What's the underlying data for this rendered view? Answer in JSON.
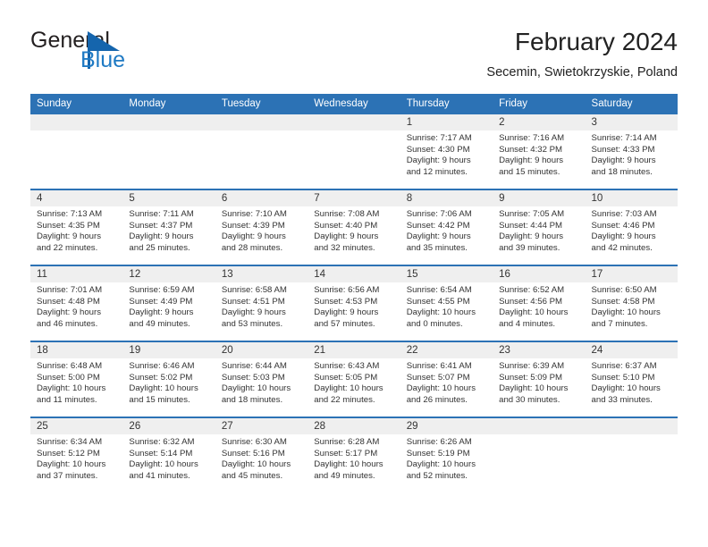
{
  "brand": {
    "name_part1": "General",
    "name_part2": "Blue",
    "mark": "triangle-logo"
  },
  "header": {
    "title": "February 2024",
    "subtitle": "Secemin, Swietokrzyskie, Poland"
  },
  "calendar": {
    "weekday_headers": [
      "Sunday",
      "Monday",
      "Tuesday",
      "Wednesday",
      "Thursday",
      "Friday",
      "Saturday"
    ],
    "accent_color": "#2c72b5",
    "daynum_band_color": "#efefef",
    "weeks": [
      [
        {
          "day": "",
          "lines": []
        },
        {
          "day": "",
          "lines": []
        },
        {
          "day": "",
          "lines": []
        },
        {
          "day": "",
          "lines": []
        },
        {
          "day": "1",
          "lines": [
            "Sunrise: 7:17 AM",
            "Sunset: 4:30 PM",
            "Daylight: 9 hours",
            "and 12 minutes."
          ]
        },
        {
          "day": "2",
          "lines": [
            "Sunrise: 7:16 AM",
            "Sunset: 4:32 PM",
            "Daylight: 9 hours",
            "and 15 minutes."
          ]
        },
        {
          "day": "3",
          "lines": [
            "Sunrise: 7:14 AM",
            "Sunset: 4:33 PM",
            "Daylight: 9 hours",
            "and 18 minutes."
          ]
        }
      ],
      [
        {
          "day": "4",
          "lines": [
            "Sunrise: 7:13 AM",
            "Sunset: 4:35 PM",
            "Daylight: 9 hours",
            "and 22 minutes."
          ]
        },
        {
          "day": "5",
          "lines": [
            "Sunrise: 7:11 AM",
            "Sunset: 4:37 PM",
            "Daylight: 9 hours",
            "and 25 minutes."
          ]
        },
        {
          "day": "6",
          "lines": [
            "Sunrise: 7:10 AM",
            "Sunset: 4:39 PM",
            "Daylight: 9 hours",
            "and 28 minutes."
          ]
        },
        {
          "day": "7",
          "lines": [
            "Sunrise: 7:08 AM",
            "Sunset: 4:40 PM",
            "Daylight: 9 hours",
            "and 32 minutes."
          ]
        },
        {
          "day": "8",
          "lines": [
            "Sunrise: 7:06 AM",
            "Sunset: 4:42 PM",
            "Daylight: 9 hours",
            "and 35 minutes."
          ]
        },
        {
          "day": "9",
          "lines": [
            "Sunrise: 7:05 AM",
            "Sunset: 4:44 PM",
            "Daylight: 9 hours",
            "and 39 minutes."
          ]
        },
        {
          "day": "10",
          "lines": [
            "Sunrise: 7:03 AM",
            "Sunset: 4:46 PM",
            "Daylight: 9 hours",
            "and 42 minutes."
          ]
        }
      ],
      [
        {
          "day": "11",
          "lines": [
            "Sunrise: 7:01 AM",
            "Sunset: 4:48 PM",
            "Daylight: 9 hours",
            "and 46 minutes."
          ]
        },
        {
          "day": "12",
          "lines": [
            "Sunrise: 6:59 AM",
            "Sunset: 4:49 PM",
            "Daylight: 9 hours",
            "and 49 minutes."
          ]
        },
        {
          "day": "13",
          "lines": [
            "Sunrise: 6:58 AM",
            "Sunset: 4:51 PM",
            "Daylight: 9 hours",
            "and 53 minutes."
          ]
        },
        {
          "day": "14",
          "lines": [
            "Sunrise: 6:56 AM",
            "Sunset: 4:53 PM",
            "Daylight: 9 hours",
            "and 57 minutes."
          ]
        },
        {
          "day": "15",
          "lines": [
            "Sunrise: 6:54 AM",
            "Sunset: 4:55 PM",
            "Daylight: 10 hours",
            "and 0 minutes."
          ]
        },
        {
          "day": "16",
          "lines": [
            "Sunrise: 6:52 AM",
            "Sunset: 4:56 PM",
            "Daylight: 10 hours",
            "and 4 minutes."
          ]
        },
        {
          "day": "17",
          "lines": [
            "Sunrise: 6:50 AM",
            "Sunset: 4:58 PM",
            "Daylight: 10 hours",
            "and 7 minutes."
          ]
        }
      ],
      [
        {
          "day": "18",
          "lines": [
            "Sunrise: 6:48 AM",
            "Sunset: 5:00 PM",
            "Daylight: 10 hours",
            "and 11 minutes."
          ]
        },
        {
          "day": "19",
          "lines": [
            "Sunrise: 6:46 AM",
            "Sunset: 5:02 PM",
            "Daylight: 10 hours",
            "and 15 minutes."
          ]
        },
        {
          "day": "20",
          "lines": [
            "Sunrise: 6:44 AM",
            "Sunset: 5:03 PM",
            "Daylight: 10 hours",
            "and 18 minutes."
          ]
        },
        {
          "day": "21",
          "lines": [
            "Sunrise: 6:43 AM",
            "Sunset: 5:05 PM",
            "Daylight: 10 hours",
            "and 22 minutes."
          ]
        },
        {
          "day": "22",
          "lines": [
            "Sunrise: 6:41 AM",
            "Sunset: 5:07 PM",
            "Daylight: 10 hours",
            "and 26 minutes."
          ]
        },
        {
          "day": "23",
          "lines": [
            "Sunrise: 6:39 AM",
            "Sunset: 5:09 PM",
            "Daylight: 10 hours",
            "and 30 minutes."
          ]
        },
        {
          "day": "24",
          "lines": [
            "Sunrise: 6:37 AM",
            "Sunset: 5:10 PM",
            "Daylight: 10 hours",
            "and 33 minutes."
          ]
        }
      ],
      [
        {
          "day": "25",
          "lines": [
            "Sunrise: 6:34 AM",
            "Sunset: 5:12 PM",
            "Daylight: 10 hours",
            "and 37 minutes."
          ]
        },
        {
          "day": "26",
          "lines": [
            "Sunrise: 6:32 AM",
            "Sunset: 5:14 PM",
            "Daylight: 10 hours",
            "and 41 minutes."
          ]
        },
        {
          "day": "27",
          "lines": [
            "Sunrise: 6:30 AM",
            "Sunset: 5:16 PM",
            "Daylight: 10 hours",
            "and 45 minutes."
          ]
        },
        {
          "day": "28",
          "lines": [
            "Sunrise: 6:28 AM",
            "Sunset: 5:17 PM",
            "Daylight: 10 hours",
            "and 49 minutes."
          ]
        },
        {
          "day": "29",
          "lines": [
            "Sunrise: 6:26 AM",
            "Sunset: 5:19 PM",
            "Daylight: 10 hours",
            "and 52 minutes."
          ]
        },
        {
          "day": "",
          "lines": []
        },
        {
          "day": "",
          "lines": []
        }
      ]
    ]
  }
}
